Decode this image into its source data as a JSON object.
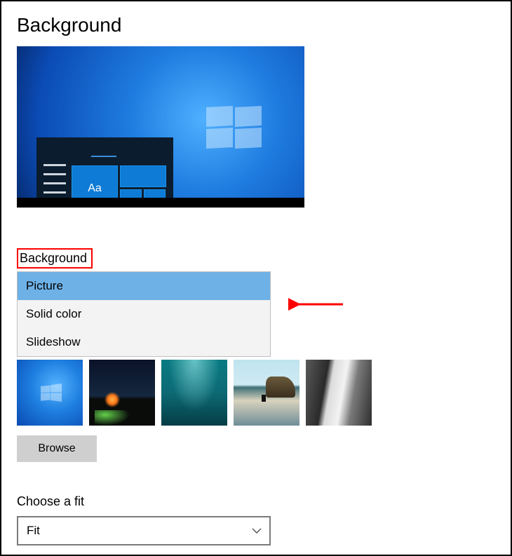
{
  "page_title": "Background",
  "preview": {
    "sample_text": "Aa"
  },
  "background_section": {
    "label": "Background",
    "options": [
      "Picture",
      "Solid color",
      "Slideshow"
    ],
    "selected": "Picture"
  },
  "thumbnails": [
    {
      "name": "windows-default"
    },
    {
      "name": "night-aurora"
    },
    {
      "name": "underwater"
    },
    {
      "name": "beach-rock"
    },
    {
      "name": "gray-cliff"
    }
  ],
  "browse_label": "Browse",
  "fit_section": {
    "label": "Choose a fit",
    "selected": "Fit"
  },
  "annotation": {
    "highlight_box": true,
    "arrow": true
  }
}
